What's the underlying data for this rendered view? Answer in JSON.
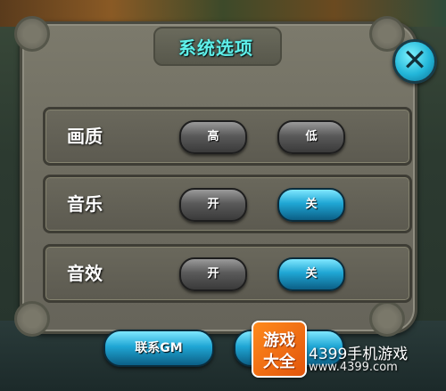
{
  "dialog": {
    "title": "系统选项",
    "close_icon": "close-icon"
  },
  "settings": [
    {
      "label": "画质",
      "left": "高",
      "right": "低",
      "selected": "none"
    },
    {
      "label": "音乐",
      "left": "开",
      "right": "关",
      "selected": "right"
    },
    {
      "label": "音效",
      "left": "开",
      "right": "关",
      "selected": "right"
    }
  ],
  "footer": {
    "contact_gm": "联系GM"
  },
  "watermark": {
    "logo_line1": "游戏",
    "logo_line2": "大全",
    "site_name": "4399手机游戏",
    "url": "www.4399.com"
  },
  "colors": {
    "title": "#5ff0ea",
    "active_button": "#1fa6d4",
    "inactive_button": "#5a5a5a",
    "panel": "#6e6c60"
  }
}
